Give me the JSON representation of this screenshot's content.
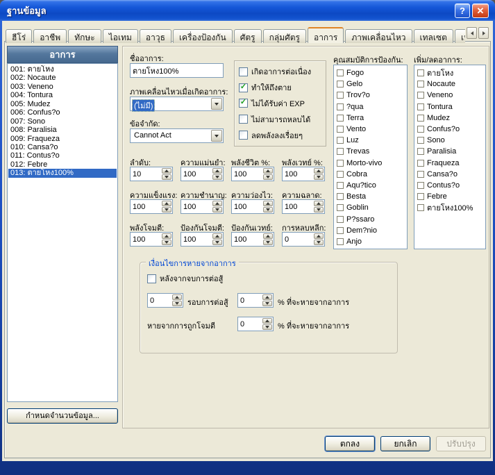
{
  "window": {
    "title": "ฐานข้อมูล"
  },
  "titlebar": {
    "help_glyph": "?",
    "close_glyph": "✕"
  },
  "tabs": [
    "ฮีโร่",
    "อาชีพ",
    "ทักษะ",
    "ไอเทม",
    "อาวุธ",
    "เครื่องป้องกัน",
    "ศัตรู",
    "กลุ่มศัตรู",
    "อาการ",
    "ภาพเคลื่อนไหว",
    "เทลเซต",
    "เหตุการณ์ทั่วไป"
  ],
  "left": {
    "header": "อาการ",
    "items": [
      "001: ตายโหง",
      "002: Nocaute",
      "003: Veneno",
      "004: Tontura",
      "005: Mudez",
      "006: Confus?o",
      "007: Sono",
      "008: Paralisia",
      "009: Fraqueza",
      "010: Cansa?o",
      "011: Contus?o",
      "012: Febre",
      "013: ตายโหง100%"
    ],
    "selected_index": 12,
    "count_button": "กำหนดจำนวนข้อมูล..."
  },
  "form": {
    "name_label": "ชื่ออาการ:",
    "name_value": "ตายโหง100%",
    "animation_label": "ภาพเคลื่อนไหวเมื่อเกิดอาการ:",
    "animation_value": "(ไม่มี)",
    "restriction_label": "ข้อจำกัด:",
    "restriction_value": "Cannot Act"
  },
  "options": [
    {
      "label": "เกิดอาการต่อเนื่อง",
      "check": ""
    },
    {
      "label": "ทำให้ถึงตาย",
      "check": "✓"
    },
    {
      "label": "ไม่ได้รับค่า EXP",
      "check": "✓"
    },
    {
      "label": "ไม่สามารถหลบได้",
      "check": ""
    },
    {
      "label": "ลดพลังลงเรื่อยๆ",
      "check": ""
    }
  ],
  "spinners": [
    {
      "label": "ลำดับ:",
      "value": "10"
    },
    {
      "label": "ความแม่นยำ:",
      "value": "100"
    },
    {
      "label": "พลังชีวิต %:",
      "value": "100"
    },
    {
      "label": "พลังเวทย์ %:",
      "value": "100"
    },
    {
      "label": "ความแข็งแรง:",
      "value": "100"
    },
    {
      "label": "ความชำนาญ:",
      "value": "100"
    },
    {
      "label": "ความว่องไว:",
      "value": "100"
    },
    {
      "label": "ความฉลาด:",
      "value": "100"
    },
    {
      "label": "พลังโจมตี:",
      "value": "100"
    },
    {
      "label": "ป้องกันโจมตี:",
      "value": "100"
    },
    {
      "label": "ป้องกันเวทย์:",
      "value": "100"
    },
    {
      "label": "การหลบหลีก:",
      "value": "0"
    }
  ],
  "guard": {
    "label": "คุณสมบัติการป้องกัน:",
    "items": [
      "Fogo",
      "Gelo",
      "Trov?o",
      "?qua",
      "Terra",
      "Vento",
      "Luz",
      "Trevas",
      "Morto-vivo",
      "Cobra",
      "Aqu?tico",
      "Besta",
      "Goblin",
      "P?ssaro",
      "Dem?nio",
      "Anjo"
    ]
  },
  "states": {
    "label": "เพิ่ม/ลดอาการ:",
    "items": [
      "ตายโหง",
      "Nocaute",
      "Veneno",
      "Tontura",
      "Mudez",
      "Confus?o",
      "Sono",
      "Paralisia",
      "Fraqueza",
      "Cansa?o",
      "Contus?o",
      "Febre",
      "ตายโหง100%"
    ]
  },
  "release": {
    "title": "เงื่อนไขการหายจากอาการ",
    "after_battle_label": "หลังจากจบการต่อสู้",
    "after_battle_check": "",
    "turns_value": "0",
    "turns_label": "รอบการต่อสู้",
    "turns_pct_value": "0",
    "pct_label": "% ที่จะหายจากอาการ",
    "damage_label": "หายจากการถูกโจมตี",
    "damage_pct_value": "0"
  },
  "footer": {
    "ok": "ตกลง",
    "cancel": "ยกเลิก",
    "apply": "ปรับปรุง"
  }
}
